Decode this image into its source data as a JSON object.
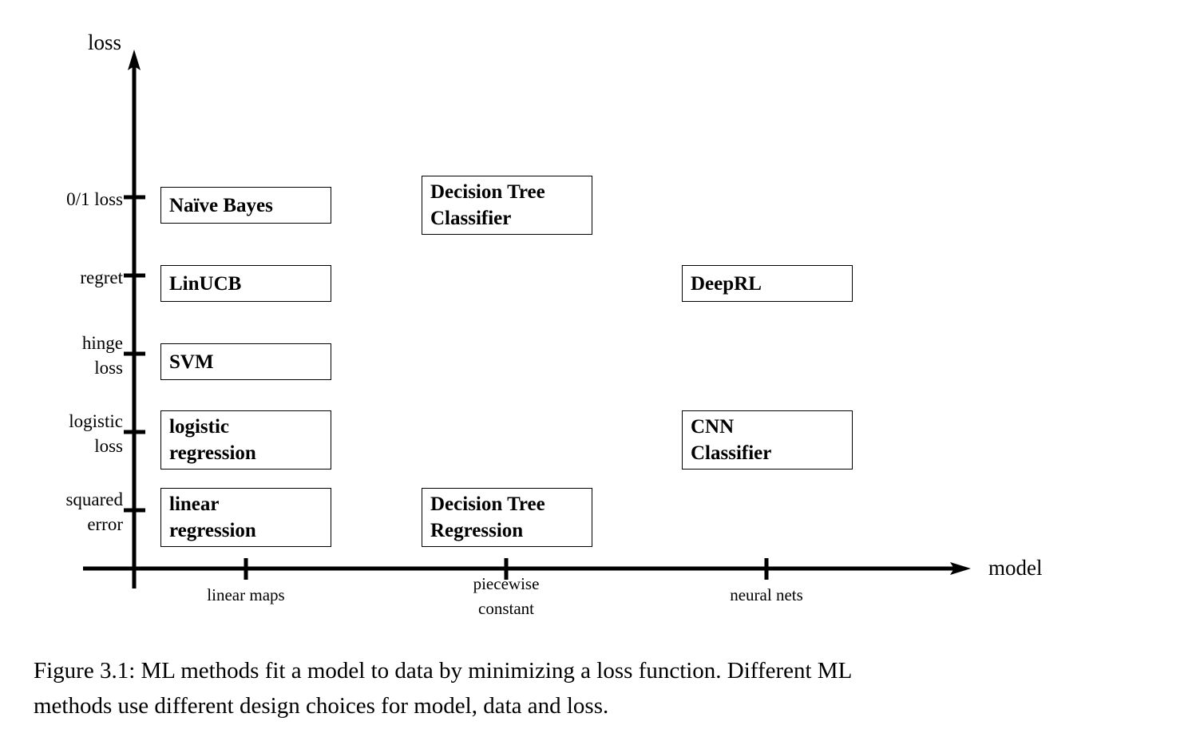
{
  "figure": {
    "axes": {
      "y_title": "loss",
      "x_title": "model"
    },
    "caption_line_1": "Figure 3.1:  ML methods fit a model to data by minimizing a loss function.  Different ML",
    "caption_line_2": "methods use different design choices for model, data and loss."
  },
  "chart_data": {
    "type": "scatter",
    "title": "",
    "xlabel": "model",
    "ylabel": "loss",
    "grid": false,
    "legend": "none",
    "x_categories": [
      "linear maps",
      "piecewise constant",
      "neural nets"
    ],
    "y_categories": [
      "squared error",
      "logistic loss",
      "hinge loss",
      "regret",
      "0/1 loss"
    ],
    "y_tick_labels": [
      "0/1 loss",
      "regret",
      "hinge\nloss",
      "logistic\nloss",
      "squared\nerror"
    ],
    "x_tick_labels": [
      "linear maps",
      "piecewise\nconstant",
      "neural nets"
    ],
    "points": [
      {
        "label": "Naïve Bayes",
        "x": "linear maps",
        "y": "0/1 loss"
      },
      {
        "label": "Decision Tree\nClassifier",
        "x": "piecewise constant",
        "y": "0/1 loss"
      },
      {
        "label": "LinUCB",
        "x": "linear maps",
        "y": "regret"
      },
      {
        "label": "DeepRL",
        "x": "neural nets",
        "y": "regret"
      },
      {
        "label": "SVM",
        "x": "linear maps",
        "y": "hinge loss"
      },
      {
        "label": "logistic\nregression",
        "x": "linear maps",
        "y": "logistic loss"
      },
      {
        "label": "CNN\nClassifier",
        "x": "neural nets",
        "y": "logistic loss"
      },
      {
        "label": "linear\nregression",
        "x": "linear maps",
        "y": "squared error"
      },
      {
        "label": "Decision Tree\nRegression",
        "x": "piecewise constant",
        "y": "squared error"
      }
    ]
  },
  "boxes": [
    {
      "name": "naive-bayes",
      "text": "Naïve Bayes"
    },
    {
      "name": "decision-tree-classifier",
      "text": "Decision Tree\nClassifier"
    },
    {
      "name": "linucb",
      "text": "LinUCB"
    },
    {
      "name": "deeprl",
      "text": "DeepRL"
    },
    {
      "name": "svm",
      "text": "SVM"
    },
    {
      "name": "logistic-regression",
      "text": "logistic\nregression"
    },
    {
      "name": "cnn-classifier",
      "text": "CNN\nClassifier"
    },
    {
      "name": "linear-regression",
      "text": "linear\nregression"
    },
    {
      "name": "decision-tree-regression",
      "text": "Decision Tree\nRegression"
    }
  ],
  "y_ticks": [
    {
      "name": "zero-one-loss",
      "label": "0/1 loss"
    },
    {
      "name": "regret",
      "label": "regret"
    },
    {
      "name": "hinge-loss",
      "label": "hinge\nloss"
    },
    {
      "name": "logistic-loss",
      "label": "logistic\nloss"
    },
    {
      "name": "squared-error",
      "label": "squared\nerror"
    }
  ],
  "x_ticks": [
    {
      "name": "linear-maps",
      "label": "linear maps"
    },
    {
      "name": "piecewise-constant",
      "label": "piecewise\nconstant"
    },
    {
      "name": "neural-nets",
      "label": "neural nets"
    }
  ],
  "colors": {
    "ink": "#000000",
    "paper": "#ffffff"
  }
}
